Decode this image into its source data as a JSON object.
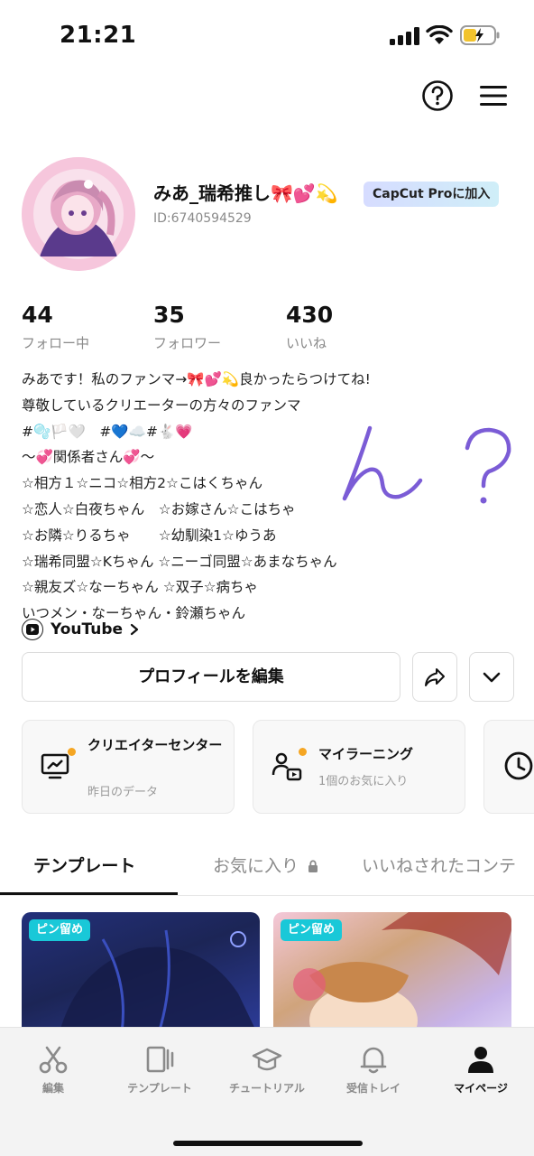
{
  "status_bar": {
    "time": "21:21"
  },
  "profile": {
    "username": "みあ_瑞希推し🎀💕💫",
    "pro_badge": "CapCut Proに加入",
    "user_id": "ID:6740594529"
  },
  "stats": [
    {
      "value": "44",
      "label": "フォロー中"
    },
    {
      "value": "35",
      "label": "フォロワー"
    },
    {
      "value": "430",
      "label": "いいね"
    }
  ],
  "bio": [
    "みあです！私のファンマ→🎀💕💫良かったらつけてね!",
    "尊敬しているクリエーターの方々のファンマ",
    "#🫧🏳️🤍　#💙☁️#🐇💗",
    "〜💞関係者さん💞〜",
    "☆相方１☆ニコ☆相方2☆こはくちゃん",
    "☆恋人☆白夜ちゃん　☆お嫁さん☆こはちゃ",
    "☆お隣☆りるちゃ　　☆幼馴染1☆ゆうあ",
    "☆瑞希同盟☆Kちゃん ☆ニーゴ同盟☆あまなちゃん",
    "☆親友ズ☆なーちゃん ☆双子☆病ちゃ",
    "いつメン・なーちゃん・鈴瀬ちゃん"
  ],
  "handwriting": "ん？",
  "youtube": {
    "label": "YouTube"
  },
  "buttons": {
    "edit_profile": "プロフィールを編集"
  },
  "cards": [
    {
      "title": "クリエイターセンター",
      "subtitle": "昨日のデータ",
      "icon": "creator-center-icon"
    },
    {
      "title": "マイラーニング",
      "subtitle": "1個のお気に入り",
      "icon": "learning-icon"
    },
    {
      "icon": "clock-icon"
    }
  ],
  "tabs": [
    {
      "label": "テンプレート",
      "active": true
    },
    {
      "label": "お気に入り",
      "locked": true
    },
    {
      "label": "いいねされたコンテ"
    }
  ],
  "templates": [
    {
      "badge": "ピン留め"
    },
    {
      "badge": "ピン留め"
    }
  ],
  "bottom_nav": [
    {
      "label": "編集",
      "icon": "scissors-icon"
    },
    {
      "label": "テンプレート",
      "icon": "template-icon"
    },
    {
      "label": "チュートリアル",
      "icon": "graduation-cap-icon"
    },
    {
      "label": "受信トレイ",
      "icon": "bell-icon"
    },
    {
      "label": "マイページ",
      "icon": "person-icon",
      "active": true
    }
  ],
  "colors": {
    "pro_badge_gradient": [
      "#d6dcff",
      "#cfeef8"
    ],
    "pin_badge": "#19c8d8",
    "notification_dot": "#f5a623",
    "handwriting": "#7b5cd6"
  }
}
